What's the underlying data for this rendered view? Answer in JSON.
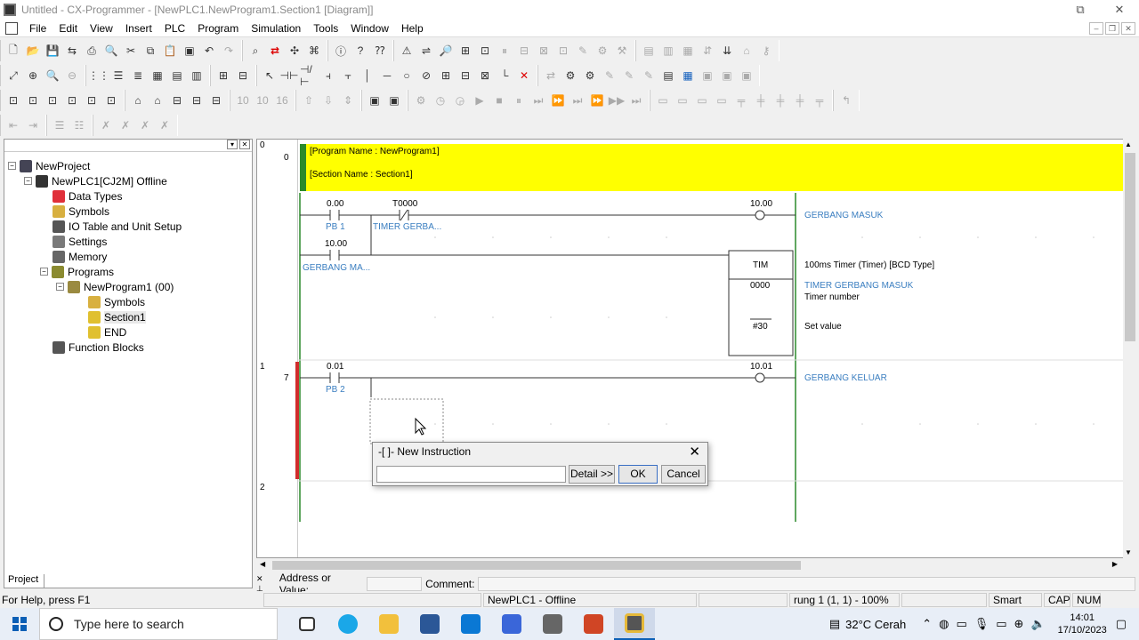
{
  "window": {
    "title": "Untitled - CX-Programmer - [NewPLC1.NewProgram1.Section1 [Diagram]]",
    "controls": [
      "⧉",
      "✕"
    ]
  },
  "menu": [
    "File",
    "Edit",
    "View",
    "Insert",
    "PLC",
    "Program",
    "Simulation",
    "Tools",
    "Window",
    "Help"
  ],
  "project_tree": {
    "tab": "Project",
    "nodes": [
      {
        "label": "NewProject"
      },
      {
        "label": "NewPLC1[CJ2M] Offline"
      },
      {
        "label": "Data Types"
      },
      {
        "label": "Symbols"
      },
      {
        "label": "IO Table and Unit Setup"
      },
      {
        "label": "Settings"
      },
      {
        "label": "Memory"
      },
      {
        "label": "Programs"
      },
      {
        "label": "NewProgram1 (00)"
      },
      {
        "label": "Symbols"
      },
      {
        "label": "Section1"
      },
      {
        "label": "END"
      },
      {
        "label": "Function Blocks"
      }
    ]
  },
  "diagram": {
    "rung_numbers": [
      "0",
      "1",
      "2"
    ],
    "step_numbers": [
      "0",
      "7"
    ],
    "program_name": "[Program Name : NewProgram1]",
    "section_name": "[Section Name : Section1]",
    "rung0": {
      "contact1_addr": "0.00",
      "contact1_label": "PB 1",
      "contact2_addr": "T0000",
      "contact2_label": "TIMER GERBA...",
      "contact3_addr": "10.00",
      "contact3_label": "GERBANG MA...",
      "coil_addr": "10.00",
      "coil_label": "GERBANG MASUK",
      "tim_name": "TIM",
      "tim_number": "0000",
      "tim_set": "#30",
      "tim_desc": "100ms Timer (Timer) [BCD Type]",
      "tim_comment": "TIMER GERBANG MASUK",
      "tim_number_label": "Timer number",
      "tim_set_label": "Set value"
    },
    "rung1": {
      "contact_addr": "0.01",
      "contact_label": "PB 2",
      "coil_addr": "10.01",
      "coil_label": "GERBANG KELUAR"
    },
    "colors": {
      "banner": "#ffff00",
      "rail": "#2b8a2b",
      "comment": "#3a7ec0",
      "error_bar": "#d12c2c"
    }
  },
  "dialog": {
    "title": "-[ ]- New Instruction",
    "input_value": "",
    "detail_button": "Detail >>",
    "ok_button": "OK",
    "cancel_button": "Cancel",
    "close": "✕"
  },
  "address_bar": {
    "address_label": "Address or Value:",
    "comment_label": "Comment:"
  },
  "status": {
    "help": "For Help, press F1",
    "plc": "NewPLC1 - Offline",
    "position": "rung 1 (1, 1)  - 100%",
    "mode": "Smart",
    "cap": "CAP",
    "num": "NUM"
  },
  "taskbar": {
    "search_placeholder": "Type here to search",
    "weather": "32°C  Cerah",
    "time": "14:01",
    "date": "17/10/2023"
  }
}
